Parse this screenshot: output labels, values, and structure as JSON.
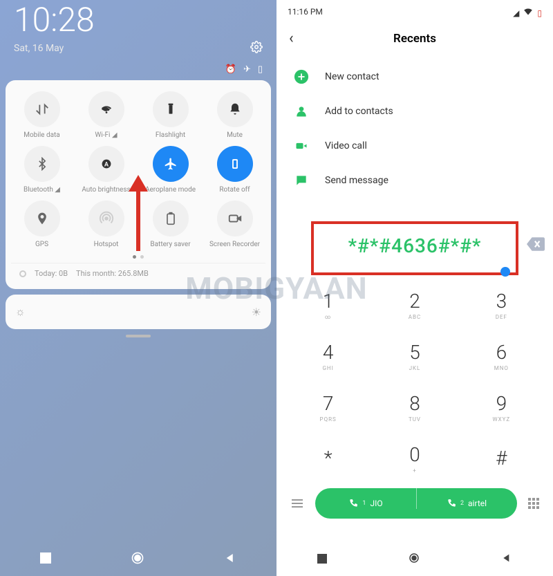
{
  "left": {
    "time": "10:28",
    "date": "Sat, 16 May",
    "tiles": [
      {
        "label": "Mobile data",
        "icon": "swap"
      },
      {
        "label": "Wi-Fi ◢",
        "icon": "wifi"
      },
      {
        "label": "Flashlight",
        "icon": "flashlight"
      },
      {
        "label": "Mute",
        "icon": "bell"
      },
      {
        "label": "Bluetooth ◢",
        "icon": "bluetooth"
      },
      {
        "label": "Auto brightness",
        "icon": "autobright"
      },
      {
        "label": "Aeroplane mode",
        "icon": "airplane"
      },
      {
        "label": "Rotate off",
        "icon": "rotate"
      },
      {
        "label": "GPS",
        "icon": "gps"
      },
      {
        "label": "Hotspot",
        "icon": "hotspot"
      },
      {
        "label": "Battery saver",
        "icon": "battery"
      },
      {
        "label": "Screen Recorder",
        "icon": "screenrec"
      }
    ],
    "usage_today": "Today: 0B",
    "usage_month": "This month: 265.8MB"
  },
  "right": {
    "status_time": "11:16 PM",
    "title": "Recents",
    "actions": {
      "new_contact": "New contact",
      "add_contacts": "Add to contacts",
      "video_call": "Video call",
      "send_message": "Send message"
    },
    "dialed": "*#*#4636#*#*",
    "keys": [
      {
        "num": "1",
        "sub": "∞"
      },
      {
        "num": "2",
        "sub": "ABC"
      },
      {
        "num": "3",
        "sub": "DEF"
      },
      {
        "num": "4",
        "sub": "GHI"
      },
      {
        "num": "5",
        "sub": "JKL"
      },
      {
        "num": "6",
        "sub": "MNO"
      },
      {
        "num": "7",
        "sub": "PQRS"
      },
      {
        "num": "8",
        "sub": "TUV"
      },
      {
        "num": "9",
        "sub": "WXYZ"
      },
      {
        "num": "*",
        "sub": ""
      },
      {
        "num": "0",
        "sub": "+"
      },
      {
        "num": "#",
        "sub": ""
      }
    ],
    "sim1": "JIO",
    "sim2": "airtel",
    "sim1_num": "1",
    "sim2_num": "2"
  },
  "watermark": "MOBIGYAAN"
}
